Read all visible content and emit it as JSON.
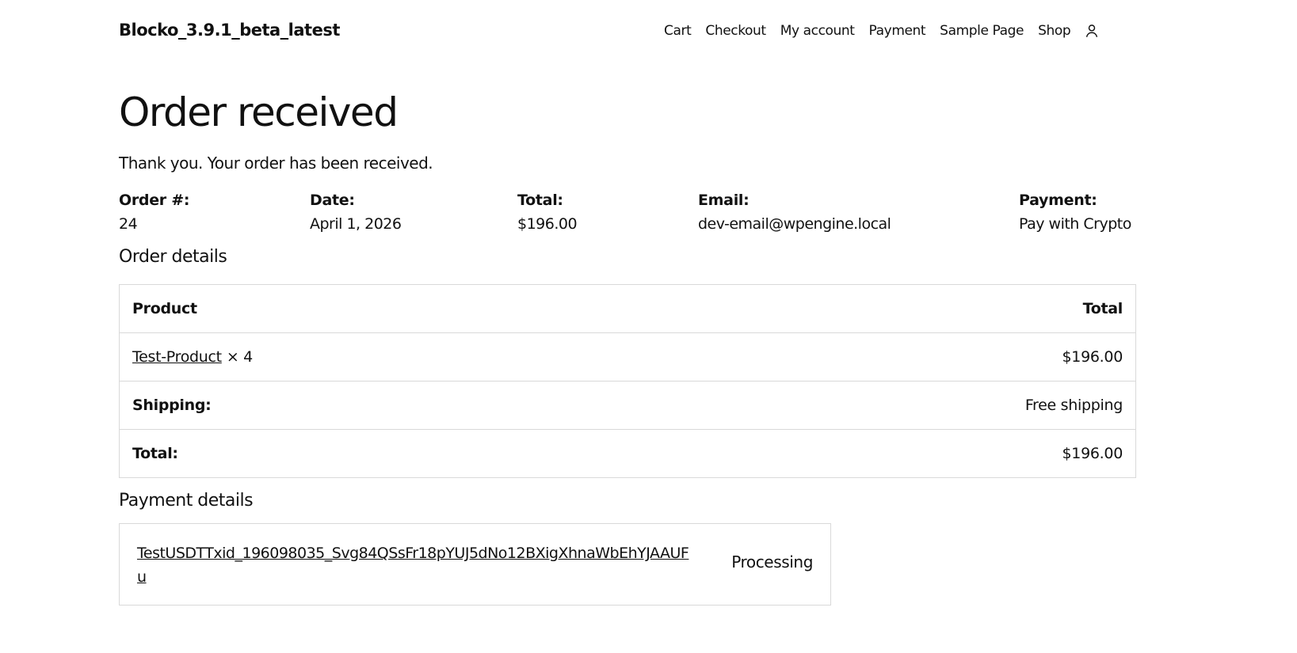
{
  "header": {
    "site_title": "Blocko_3.9.1_beta_latest",
    "nav": [
      {
        "label": "Cart"
      },
      {
        "label": "Checkout"
      },
      {
        "label": "My account"
      },
      {
        "label": "Payment"
      },
      {
        "label": "Sample Page"
      },
      {
        "label": "Shop"
      }
    ],
    "account_icon": "user-icon"
  },
  "main": {
    "title": "Order received",
    "thank_you": "Thank you. Your order has been received.",
    "overview": {
      "order_number": {
        "label": "Order #:",
        "value": "24"
      },
      "date": {
        "label": "Date:",
        "value": "April 1, 2026"
      },
      "total": {
        "label": "Total:",
        "value": "$196.00"
      },
      "email": {
        "label": "Email:",
        "value": "dev-email@wpengine.local"
      },
      "payment": {
        "label": "Payment:",
        "value": "Pay with Crypto"
      }
    },
    "order_details": {
      "title": "Order details",
      "headers": {
        "product": "Product",
        "total": "Total"
      },
      "item": {
        "name": "Test-Product",
        "qty": "× 4",
        "total": "$196.00"
      },
      "shipping": {
        "label": "Shipping:",
        "value": "Free shipping"
      },
      "grand_total": {
        "label": "Total:",
        "value": "$196.00"
      }
    },
    "payment_details": {
      "title": "Payment details",
      "txid": "TestUSDTTxid_196098035_Svg84QSsFr18pYUJ5dNo12BXigXhnaWbEhYJAAUFu",
      "status": "Processing"
    }
  }
}
